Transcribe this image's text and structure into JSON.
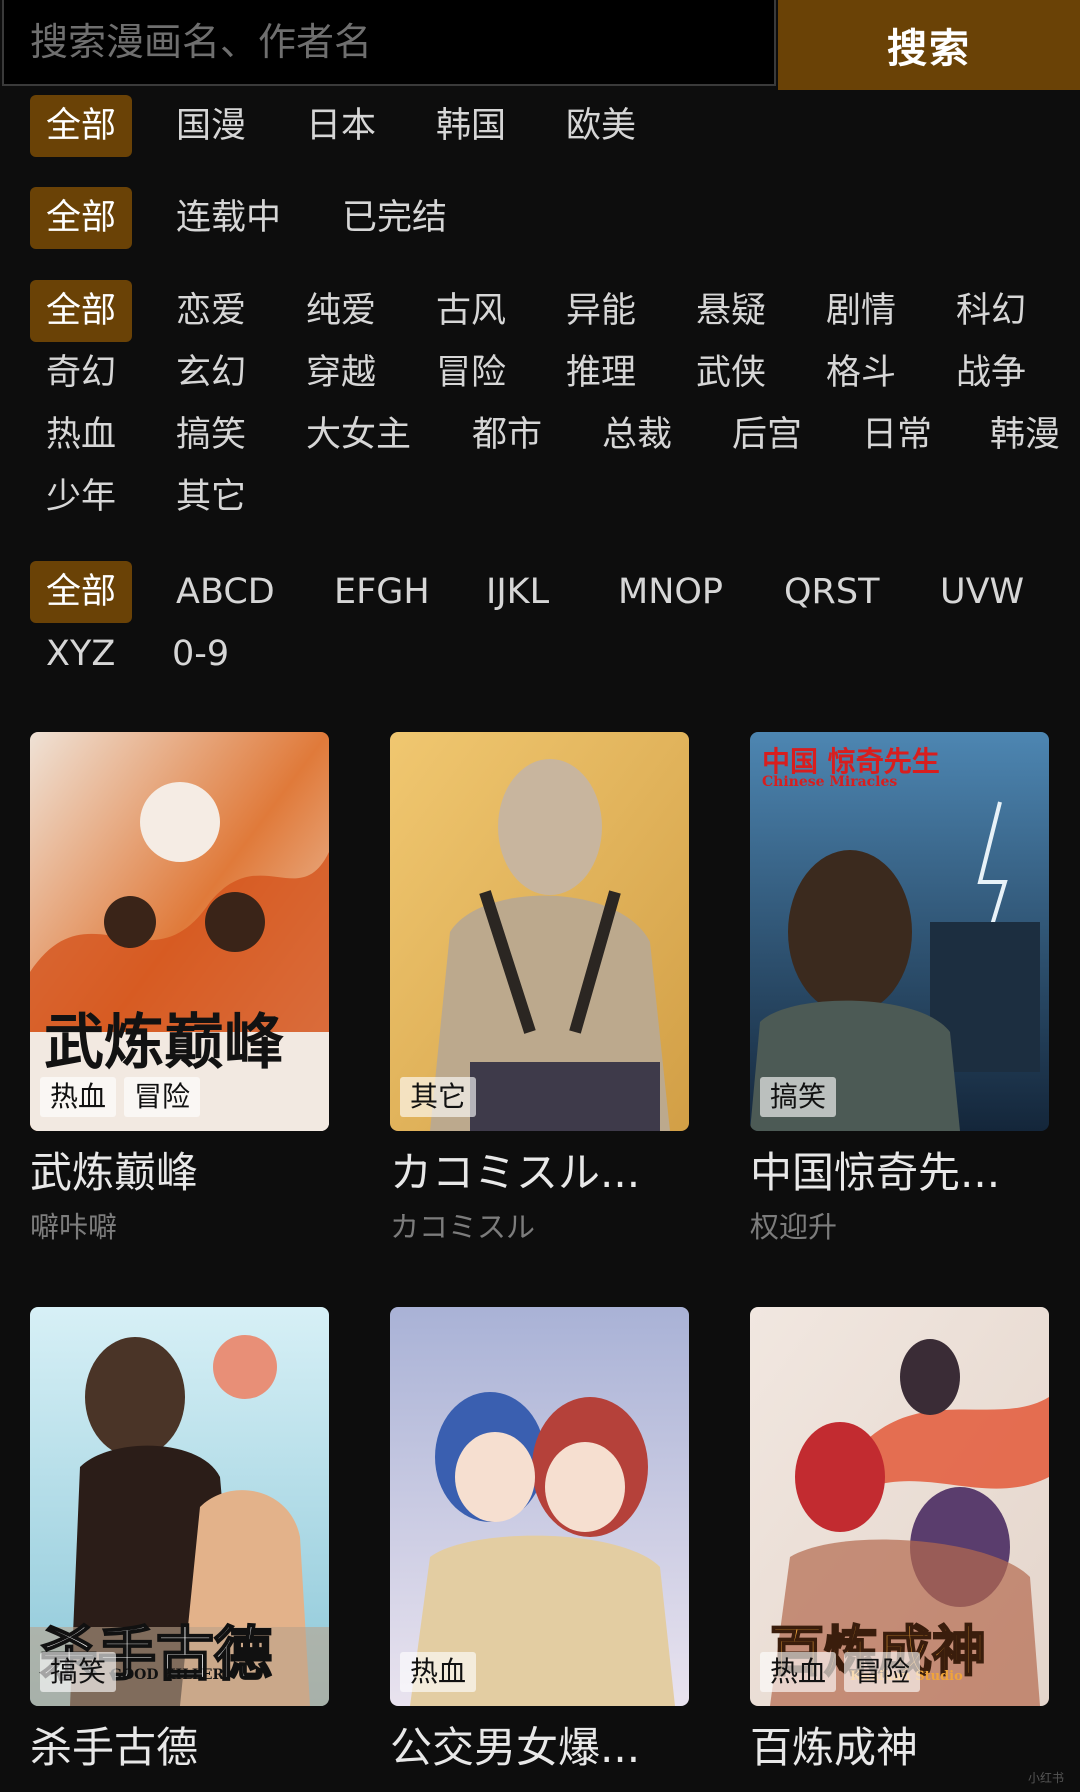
{
  "search": {
    "placeholder": "搜索漫画名、作者名",
    "button_label": "搜索"
  },
  "filters": {
    "region": [
      "全部",
      "国漫",
      "日本",
      "韩国",
      "欧美"
    ],
    "status": [
      "全部",
      "连载中",
      "已完结"
    ],
    "genre": [
      "全部",
      "恋爱",
      "纯爱",
      "古风",
      "异能",
      "悬疑",
      "剧情",
      "科幻",
      "奇幻",
      "玄幻",
      "穿越",
      "冒险",
      "推理",
      "武侠",
      "格斗",
      "战争",
      "热血",
      "搞笑",
      "大女主",
      "都市",
      "总裁",
      "后宫",
      "日常",
      "韩漫",
      "少年",
      "其它"
    ],
    "letter": [
      "全部",
      "ABCD",
      "EFGH",
      "IJKL",
      "MNOP",
      "QRST",
      "UVW",
      "XYZ",
      "0-9"
    ]
  },
  "comics": [
    {
      "title": "武炼巅峰",
      "author": "噼咔噼",
      "tags": [
        "热血",
        "冒险"
      ],
      "cover_text": "武炼巅峰",
      "cover_colors": [
        "#e9d6c6",
        "#d35a21",
        "#3a2418"
      ]
    },
    {
      "title": "カコミスル...",
      "author": "カコミスル",
      "tags": [
        "其它"
      ],
      "cover_text": "",
      "cover_colors": [
        "#e3b560",
        "#c9b496",
        "#2b2622"
      ]
    },
    {
      "title": "中国惊奇先...",
      "author": "权迎升",
      "tags": [
        "搞笑"
      ],
      "cover_text": "中国 惊奇先生",
      "cover_subtext": "Chinese Miracles",
      "cover_colors": [
        "#3c6f9c",
        "#1a2f44",
        "#cfe0ea"
      ]
    },
    {
      "title": "杀手古德",
      "author": "",
      "tags": [
        "搞笑"
      ],
      "cover_text": "杀手古德",
      "cover_subtext": "GOOD KILLER",
      "cover_colors": [
        "#bfe4f0",
        "#4a3427",
        "#e88f77"
      ]
    },
    {
      "title": "公交男女爆...",
      "author": "",
      "tags": [
        "热血"
      ],
      "cover_text": "",
      "cover_colors": [
        "#b9bedb",
        "#e9ddc7",
        "#3a5fb0"
      ]
    },
    {
      "title": "百炼成神",
      "author": "",
      "tags": [
        "热血",
        "冒险"
      ],
      "cover_text": "百炼成神",
      "cover_subtext": "Kuaikan Studio",
      "cover_colors": [
        "#ece0d8",
        "#c22b30",
        "#5a3d6d"
      ]
    }
  ],
  "watermark": "小红书"
}
